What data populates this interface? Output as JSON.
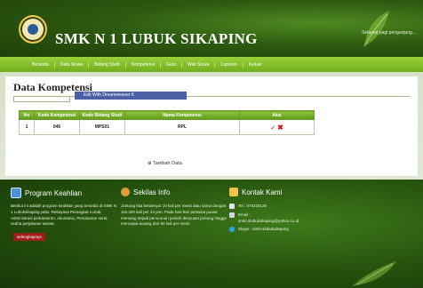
{
  "header": {
    "school_name": "SMK N 1 LUBUK SIKAPING",
    "welcome": "Selamat pagi pengunjung...",
    "logo_icon": "school-emblem-icon"
  },
  "nav": {
    "items": [
      "Beranda",
      "Data Siswa",
      "Bidang Studi",
      "Kompetensi",
      "Guru",
      "Wali Siswa",
      "Laporan",
      "Keluar"
    ]
  },
  "content": {
    "title": "Data Kompetensi",
    "tooltip": "Edit With Dreamweaver 8",
    "table": {
      "headers": [
        "No",
        "Kode Kompetensi",
        "Kode Bidang Studi",
        "Nama Kompetensi",
        "Aksi"
      ],
      "rows": [
        {
          "no": "1",
          "kode_kompetensi": "046",
          "kode_bidang_studi": "MPS01",
          "nama_kompetensi": "RPL",
          "edit_icon": "check-edit-icon",
          "delete_icon": "x-delete-icon"
        }
      ]
    },
    "add_link": "⊕ Tambah Data"
  },
  "footer": {
    "program": {
      "title": "Program Keahlian",
      "icon": "monitor-icon",
      "text": "Berikut ini adalah program keahlian yang tersedia di SMK N 1 Lubuksikaping yaitu: Rekayasa Perangkat Lunak, Administrasi perkantoran, Akuntansi, Pemasaran serta usaha perjalanan wisata.",
      "button": "selengkapnya"
    },
    "info": {
      "title": "Sekilas Info",
      "icon": "person-icon",
      "text": "Jantung kita berdenyut 10 kali per menit atau sama dengan 115.200 kali per 24 jam. Pada hari-hari pertama puasa memang terjadi penurunan jumlah denyutan jantung hingga mencapai kurang dari 60 kali per menit"
    },
    "contact": {
      "title": "Kontak Kami",
      "icon": "home-icon",
      "phone": "Tel : 075225125",
      "email_label": "Email :",
      "email": "smkn1lubuksikaping@yahoo.co.id",
      "skype": "Skype : smkn1lubuksikaping"
    }
  },
  "colors": {
    "header_green": "#2d5b10",
    "nav_green": "#7fbb25",
    "footer_green": "#24500d",
    "tooltip_blue": "#4a5fa4",
    "delete_red": "#d01818"
  }
}
